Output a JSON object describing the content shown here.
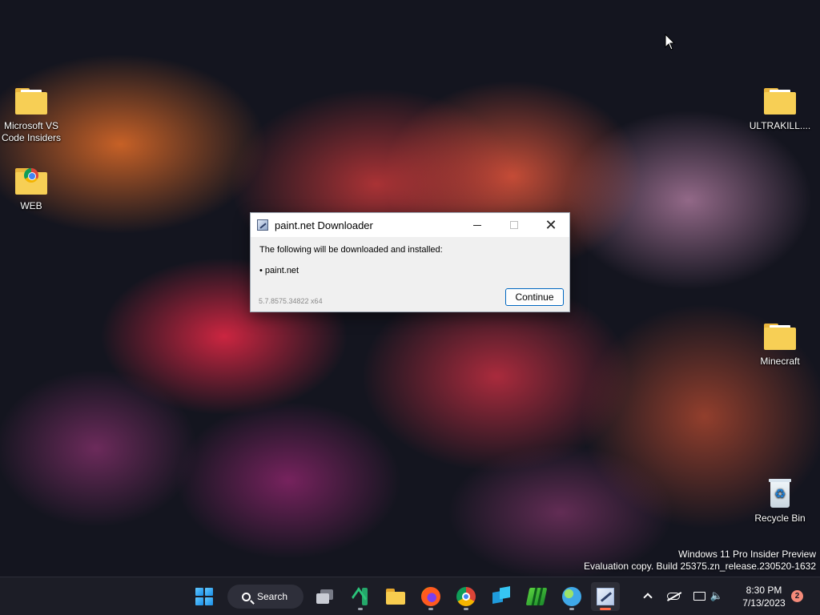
{
  "desktop": {
    "icons": [
      {
        "label": "Microsoft VS Code Insiders",
        "type": "folder"
      },
      {
        "label": "WEB",
        "type": "folder-chrome"
      },
      {
        "label": "ULTRAKILL....",
        "type": "folder"
      },
      {
        "label": "Minecraft",
        "type": "folder"
      },
      {
        "label": "Recycle Bin",
        "type": "recycle-bin"
      }
    ],
    "watermark": {
      "line1": "Windows 11 Pro Insider Preview",
      "line2": "Evaluation copy. Build 25375.zn_release.230520-1632"
    }
  },
  "dialog": {
    "title": "paint.net Downloader",
    "message": "The following will be downloaded and installed:",
    "item": "• paint.net",
    "version": "5.7.8575.34822 x64",
    "continue_label": "Continue",
    "close_glyph": "✕"
  },
  "taskbar": {
    "search_label": "Search",
    "apps": [
      "start",
      "task-view",
      "vscode",
      "file-explorer",
      "firefox",
      "chrome",
      "azure-data-studio",
      "minecraft-launcher",
      "globe-app",
      "paint-net"
    ],
    "active_app": "paint-net",
    "tray": {
      "time": "8:30 PM",
      "date": "7/13/2023",
      "notifications": "2"
    }
  },
  "colors": {
    "accent": "#0067c0",
    "folder": "#f7cf55",
    "active_indicator": "#ff6b4a",
    "badge": "#f58b7a"
  }
}
